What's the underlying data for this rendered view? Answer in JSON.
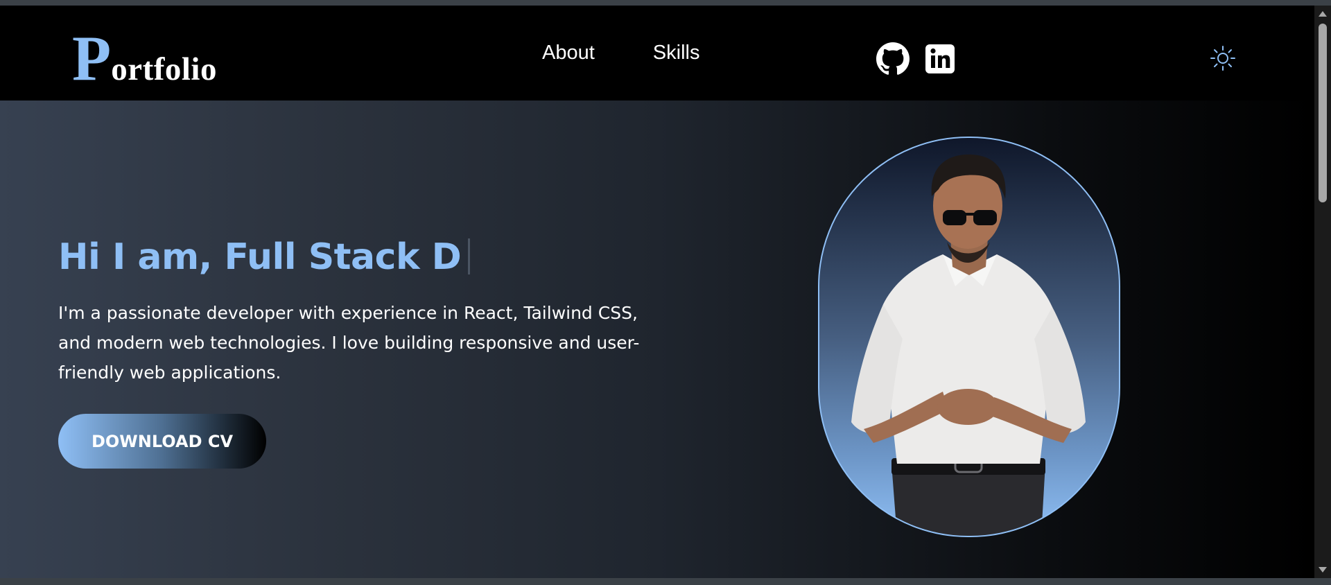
{
  "navbar": {
    "logo_initial": "P",
    "logo_rest": "ortfolio",
    "links": [
      {
        "label": "About"
      },
      {
        "label": "Skills"
      }
    ],
    "social_icons": [
      "github-icon",
      "linkedin-icon"
    ],
    "theme_icon": "sun-icon"
  },
  "hero": {
    "headline": "Hi I am, Full Stack D",
    "intro": "I'm a passionate developer with experience in React, Tailwind CSS, and modern web technologies. I love building responsive and user-friendly web applications.",
    "cv_button_label": "DOWNLOAD CV"
  },
  "colors": {
    "accent": "#8fbff5",
    "nav_background": "#000000",
    "hero_gradient_start": "#374151",
    "hero_gradient_end": "#000000"
  }
}
